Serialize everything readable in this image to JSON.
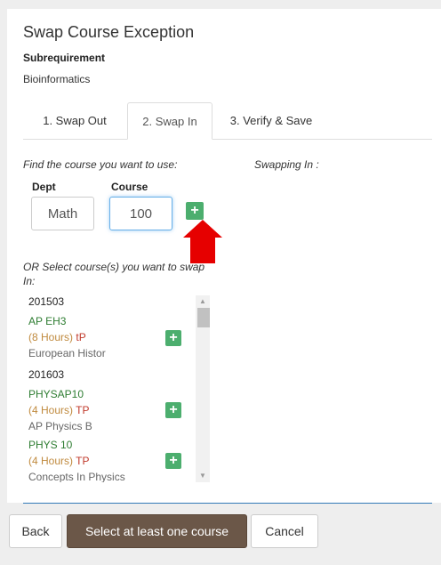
{
  "dialog": {
    "title": "Swap Course Exception",
    "subrequirement_label": "Subrequirement",
    "subrequirement_value": "Bioinformatics"
  },
  "tabs": [
    {
      "label": "1. Swap Out",
      "active": false
    },
    {
      "label": "2. Swap In",
      "active": true
    },
    {
      "label": "3. Verify & Save",
      "active": false
    }
  ],
  "search": {
    "find_label": "Find the course you want to use:",
    "swapping_label": "Swapping In :",
    "dept_label": "Dept",
    "course_label": "Course",
    "dept_value": "Math",
    "course_value": "100"
  },
  "list": {
    "or_label": "OR Select course(s) you want to swap In:",
    "items": [
      {
        "type": "term",
        "text": "201503"
      },
      {
        "type": "course",
        "code": "AP EH3",
        "hours": "(8 Hours)",
        "grade": "tP",
        "name": "European Histor"
      },
      {
        "type": "term",
        "text": "201603"
      },
      {
        "type": "course",
        "code": "PHYSAP10",
        "hours": "(4 Hours)",
        "grade": "TP",
        "name": "AP Physics B"
      },
      {
        "type": "course",
        "code": "PHYS 10",
        "hours": "(4 Hours)",
        "grade": "TP",
        "name": "Concepts In Physics"
      }
    ]
  },
  "footer": {
    "back_label": "Back",
    "select_label": "Select at least one course",
    "cancel_label": "Cancel"
  },
  "icons": {
    "add": "plus-icon",
    "pointer": "red-arrow-pointer"
  },
  "colors": {
    "accent_green": "#4cae6e",
    "primary_button": "#6b5748",
    "arrow_red": "#e60000"
  }
}
